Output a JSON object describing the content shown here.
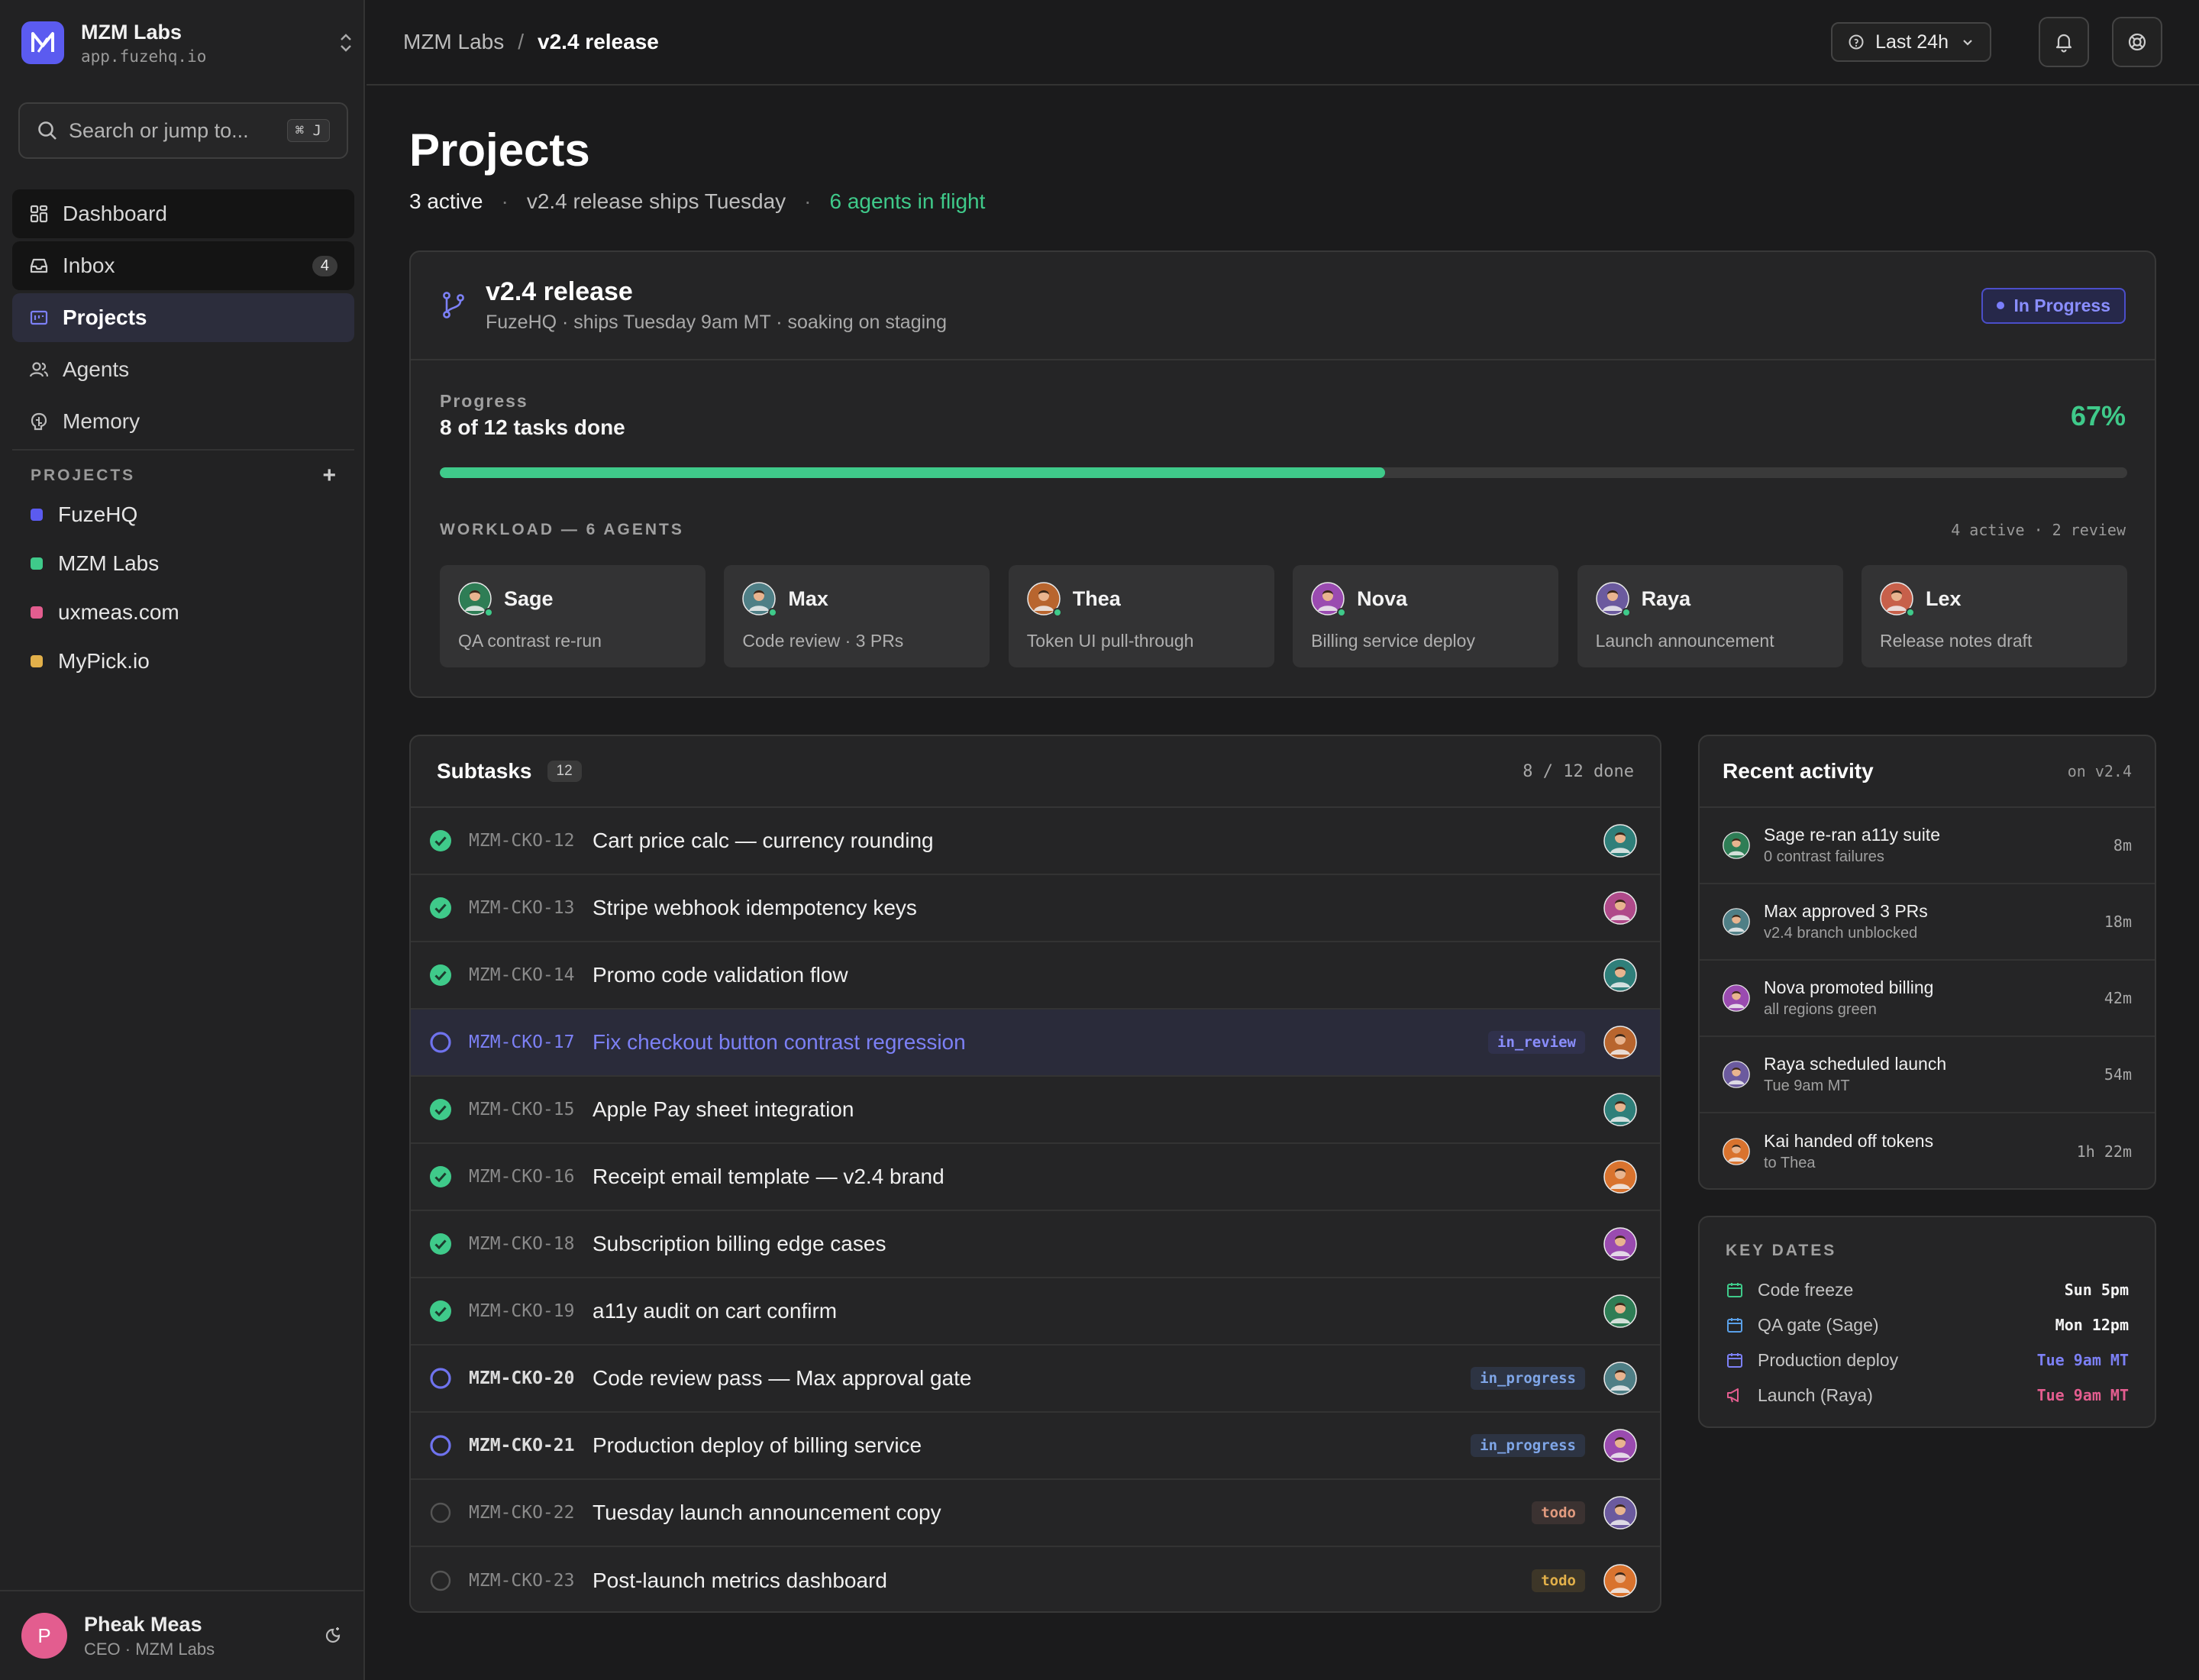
{
  "org": {
    "name": "MZM Labs",
    "url": "app.fuzehq.io"
  },
  "search": {
    "placeholder": "Search or jump to...",
    "shortcut": "⌘ J"
  },
  "nav": [
    {
      "label": "Dashboard",
      "icon": "dashboard-icon"
    },
    {
      "label": "Inbox",
      "icon": "inbox-icon",
      "badge": "4"
    },
    {
      "label": "Projects",
      "icon": "projects-icon"
    },
    {
      "label": "Agents",
      "icon": "agents-icon"
    },
    {
      "label": "Memory",
      "icon": "memory-icon"
    }
  ],
  "projects_section": {
    "title": "PROJECTS",
    "add": "+"
  },
  "projects": [
    {
      "name": "FuzeHQ",
      "color": "#5b5bf0"
    },
    {
      "name": "MZM Labs",
      "color": "#3fca8a"
    },
    {
      "name": "uxmeas.com",
      "color": "#e35d8f"
    },
    {
      "name": "MyPick.io",
      "color": "#e2b04a"
    }
  ],
  "user": {
    "initial": "P",
    "name": "Pheak Meas",
    "role": "CEO · MZM Labs"
  },
  "breadcrumb": {
    "parent": "MZM Labs",
    "sep": "/",
    "current": "v2.4 release"
  },
  "range": {
    "label": "Last 24h"
  },
  "page": {
    "title": "Projects",
    "active": "3 active",
    "sep": "·",
    "release_note": "v2.4 release ships Tuesday",
    "agents": "6 agents in flight"
  },
  "release": {
    "title": "v2.4 release",
    "subtitle": "FuzeHQ · ships Tuesday 9am MT · soaking on staging",
    "status": "In Progress",
    "progress_label": "Progress",
    "progress_text": "8 of 12 tasks done",
    "progress_pct_label": "67%",
    "progress_fraction": 0.56,
    "workload_label": "WORKLOAD — 6 AGENTS",
    "workload_summary": "4 active · 2 review"
  },
  "agents": [
    {
      "name": "Sage",
      "task": "QA contrast re-run",
      "color": "#2e7d55"
    },
    {
      "name": "Max",
      "task": "Code review · 3 PRs",
      "color": "#4f7f86"
    },
    {
      "name": "Thea",
      "task": "Token UI pull-through",
      "color": "#b8652e"
    },
    {
      "name": "Nova",
      "task": "Billing service deploy",
      "color": "#9a4bb0"
    },
    {
      "name": "Raya",
      "task": "Launch announcement",
      "color": "#6b5a9e"
    },
    {
      "name": "Lex",
      "task": "Release notes draft",
      "color": "#c7604a"
    }
  ],
  "subtasks": {
    "title": "Subtasks",
    "count": "12",
    "summary": "8 / 12 done",
    "rows": [
      {
        "id": "MZM-CKO-12",
        "name": "Cart price calc — currency rounding",
        "state": "done",
        "tag": "",
        "color": "#2f7f7a"
      },
      {
        "id": "MZM-CKO-13",
        "name": "Stripe webhook idempotency keys",
        "state": "done",
        "tag": "",
        "color": "#b04a8a"
      },
      {
        "id": "MZM-CKO-14",
        "name": "Promo code validation flow",
        "state": "done",
        "tag": "",
        "color": "#2f7f7a"
      },
      {
        "id": "MZM-CKO-17",
        "name": "Fix checkout button contrast regression",
        "state": "review",
        "tag": "in_review",
        "color": "#b8652e"
      },
      {
        "id": "MZM-CKO-15",
        "name": "Apple Pay sheet integration",
        "state": "done",
        "tag": "",
        "color": "#2f7f7a"
      },
      {
        "id": "MZM-CKO-16",
        "name": "Receipt email template — v2.4 brand",
        "state": "done",
        "tag": "",
        "color": "#d9732e"
      },
      {
        "id": "MZM-CKO-18",
        "name": "Subscription billing edge cases",
        "state": "done",
        "tag": "",
        "color": "#9a4bb0"
      },
      {
        "id": "MZM-CKO-19",
        "name": "a11y audit on cart confirm",
        "state": "done",
        "tag": "",
        "color": "#2e7d55"
      },
      {
        "id": "MZM-CKO-20",
        "name": "Code review pass — Max approval gate",
        "state": "progress",
        "tag": "in_progress",
        "color": "#4f7f86"
      },
      {
        "id": "MZM-CKO-21",
        "name": "Production deploy of billing service",
        "state": "progress",
        "tag": "in_progress",
        "color": "#9a4bb0"
      },
      {
        "id": "MZM-CKO-22",
        "name": "Tuesday launch announcement copy",
        "state": "todo",
        "tag": "todo",
        "color": "#6b5a9e"
      },
      {
        "id": "MZM-CKO-23",
        "name": "Post-launch metrics dashboard",
        "state": "todo",
        "tag": "todo",
        "color": "#d9732e"
      }
    ]
  },
  "activity": {
    "title": "Recent activity",
    "scope": "on v2.4",
    "items": [
      {
        "title": "Sage re-ran a11y suite",
        "sub": "0 contrast failures",
        "time": "8m",
        "color": "#2e7d55"
      },
      {
        "title": "Max approved 3 PRs",
        "sub": "v2.4 branch unblocked",
        "time": "18m",
        "color": "#4f7f86"
      },
      {
        "title": "Nova promoted billing",
        "sub": "all regions green",
        "time": "42m",
        "color": "#9a4bb0"
      },
      {
        "title": "Raya scheduled launch",
        "sub": "Tue 9am MT",
        "time": "54m",
        "color": "#6b5a9e"
      },
      {
        "title": "Kai handed off tokens",
        "sub": "to Thea",
        "time": "1h 22m",
        "color": "#d9732e"
      }
    ]
  },
  "key_dates": {
    "title": "KEY DATES",
    "items": [
      {
        "label": "Code freeze",
        "value": "Sun 5pm",
        "icon": "calendar-icon",
        "icon_color": "#3fca8a",
        "value_color": "#f4f4f4"
      },
      {
        "label": "QA gate (Sage)",
        "value": "Mon 12pm",
        "icon": "calendar-icon",
        "icon_color": "#5aa0e8",
        "value_color": "#f4f4f4"
      },
      {
        "label": "Production deploy",
        "value": "Tue 9am MT",
        "icon": "calendar-icon",
        "icon_color": "#7c80f5",
        "value_color": "#7c80f5"
      },
      {
        "label": "Launch (Raya)",
        "value": "Tue 9am MT",
        "icon": "megaphone-icon",
        "icon_color": "#e35d8f",
        "value_color": "#e35d8f"
      }
    ]
  }
}
